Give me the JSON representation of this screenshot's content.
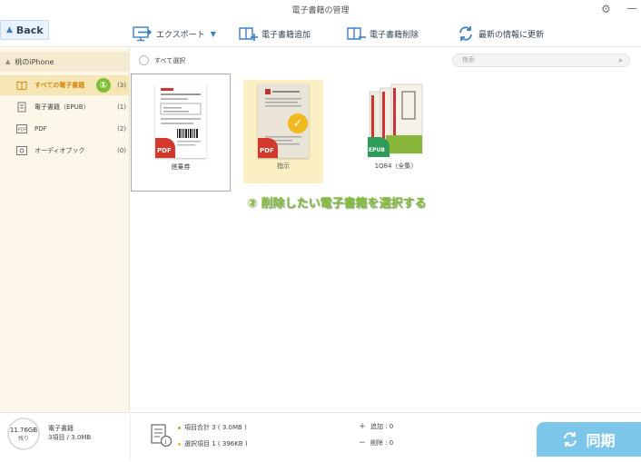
{
  "window": {
    "title": "電子書籍の管理"
  },
  "toolbar": {
    "back_label": "Back",
    "export_label": "エクスポート",
    "add_label": "電子書籍追加",
    "delete_label": "電子書籍削除",
    "refresh_label": "最新の情報に更新"
  },
  "sidebar": {
    "device_label": "桃のiPhone",
    "items": [
      {
        "label": "すべての電子書籍",
        "count": "(3)"
      },
      {
        "label": "電子書籍（EPUB）",
        "count": "(1)"
      },
      {
        "label": "PDF",
        "count": "(2)"
      },
      {
        "label": "オーディオブック",
        "count": "(0)"
      }
    ],
    "step_badge": "①"
  },
  "filter": {
    "select_all_label": "すべて選択",
    "search_placeholder": "検索"
  },
  "books": [
    {
      "name": "搭乗券",
      "format": "PDF",
      "selected": false
    },
    {
      "name": "指示",
      "format": "PDF",
      "selected": true
    },
    {
      "name": "1Q84（全集）",
      "format": "EPUB",
      "selected": false
    }
  ],
  "hint_text": "② 削除したい電子書籍を選択する",
  "status": {
    "storage_free": "11.76GB",
    "storage_free_label": "残り",
    "category_label": "電子書籍",
    "category_detail": "3項目 / 3.0MB",
    "total_label": "項目合計 3 ( 3.0MB )",
    "selected_label": "選択項目 1 ( 396KB )",
    "add_label": "追加 : 0",
    "delete_label": "削除 : 0",
    "sync_label": "同期"
  },
  "colors": {
    "accent_green": "#7ebd35",
    "accent_orange": "#d48a12",
    "sync_blue": "#7cc6e9",
    "pdf_red": "#d2392c",
    "epub_green": "#2d9c5a"
  }
}
